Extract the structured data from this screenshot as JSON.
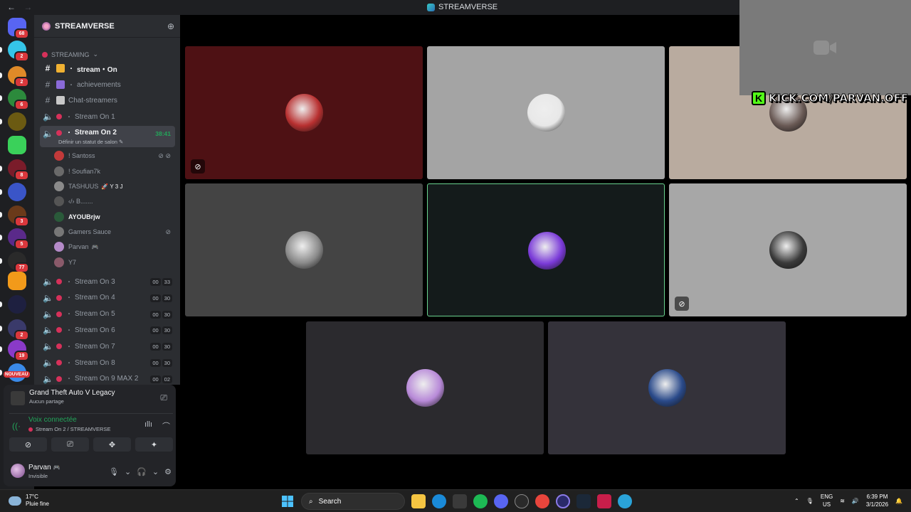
{
  "window": {
    "title": "STREAMVERSE",
    "back": "←",
    "forward": "→"
  },
  "guilds": [
    {
      "badge": "68",
      "color": "#5865f2"
    },
    {
      "badge": "2",
      "color": "#35c5e8"
    },
    {
      "badge": "2",
      "color": "#e08a28"
    },
    {
      "badge": "6",
      "color": "#2c8a3c"
    },
    {
      "badge": "",
      "color": "#6b5a12"
    },
    {
      "badge": "",
      "color": "#3ad15a"
    },
    {
      "badge": "8",
      "color": "#7a1c2a"
    },
    {
      "badge": "",
      "color": "#3a55c8"
    },
    {
      "badge": "3",
      "color": "#6a3a1a"
    },
    {
      "badge": "5",
      "color": "#5a2a8a"
    },
    {
      "badge": "77",
      "color": "#2a2a2a"
    },
    {
      "badge": "",
      "color": "#f29a1a"
    },
    {
      "badge": "",
      "color": "#1e2040"
    },
    {
      "badge": "2",
      "color": "#3a3a6a"
    },
    {
      "badge": "19",
      "color": "#8a3ac8"
    },
    {
      "badge": "",
      "color": "#3a8ae8"
    }
  ],
  "guild_label_new": "NOUVEAU",
  "server": {
    "name": "STREAMVERSE",
    "category": "STREAMING",
    "channels": [
      {
        "name": "stream・On",
        "kind": "text"
      },
      {
        "name": "achievements",
        "kind": "text"
      },
      {
        "name": "Chat-streamers",
        "kind": "text"
      },
      {
        "name": "Stream On 1",
        "kind": "voice"
      },
      {
        "name": "Stream On 2",
        "kind": "voice",
        "timer": "38:41",
        "status": "Définir un statut de salon"
      }
    ],
    "voice_users": [
      {
        "name": "! Santoss",
        "color": "#c23a3a"
      },
      {
        "name": "! Soufian7k",
        "color": "#6a6a6a"
      },
      {
        "name": "TASHUUS",
        "suffix": "🚀 Y 3 J",
        "color": "#8a8a8a"
      },
      {
        "name": "‹/› B.......",
        "color": "#555"
      },
      {
        "name": "AYOUBrjw",
        "color": "#2a5a3a"
      },
      {
        "name": "Gamers Sauce",
        "color": "#777"
      },
      {
        "name": "Parvan",
        "suffix": "🎮",
        "color": "#b48ac8"
      },
      {
        "name": "Y7",
        "color": "#8a5a6a"
      }
    ],
    "more_channels": [
      {
        "name": "Stream On 3",
        "a": "00",
        "b": "33"
      },
      {
        "name": "Stream On 4",
        "a": "00",
        "b": "30"
      },
      {
        "name": "Stream On 5",
        "a": "00",
        "b": "30"
      },
      {
        "name": "Stream On 6",
        "a": "00",
        "b": "30"
      },
      {
        "name": "Stream On 7",
        "a": "00",
        "b": "30"
      },
      {
        "name": "Stream On 8",
        "a": "00",
        "b": "30"
      },
      {
        "name": "Stream On 9 MAX 2",
        "a": "00",
        "b": "02"
      }
    ]
  },
  "activity": {
    "game": "Grand Theft Auto V Legacy",
    "sub": "Aucun partage"
  },
  "voice": {
    "title": "Voix connectée",
    "sub": "Stream On 2 / STREAMVERSE"
  },
  "me": {
    "name": "Parvan",
    "suffix": "🎮",
    "status": "Invisible"
  },
  "stage": {
    "tiles": [
      {
        "bg": "#4e1114",
        "av": "#b83030"
      },
      {
        "bg": "#a4a4a4",
        "av": "#e8e8e8"
      },
      {
        "bg": "#b9ab9f",
        "av": "#6a5a55"
      },
      {
        "bg": "#444444",
        "av": "#8a8a8a"
      },
      {
        "bg": "#141b1b",
        "av": "#7a3ad8"
      },
      {
        "bg": "#a7a7a7",
        "av": "#3a3a3a"
      },
      {
        "bg": "#2b2a2e",
        "av": "#b88ad8"
      },
      {
        "bg": "#34323a",
        "av": "#2a4a8a"
      }
    ],
    "overlay_text": "KICK.COM/PARVAN.OFF",
    "overlay_k": "K"
  },
  "taskbar": {
    "temp": "17°C",
    "cond": "Pluie fine",
    "search": "Search",
    "lang1": "ENG",
    "lang2": "US",
    "time": "6:39 PM",
    "date": "3/1/2026"
  }
}
